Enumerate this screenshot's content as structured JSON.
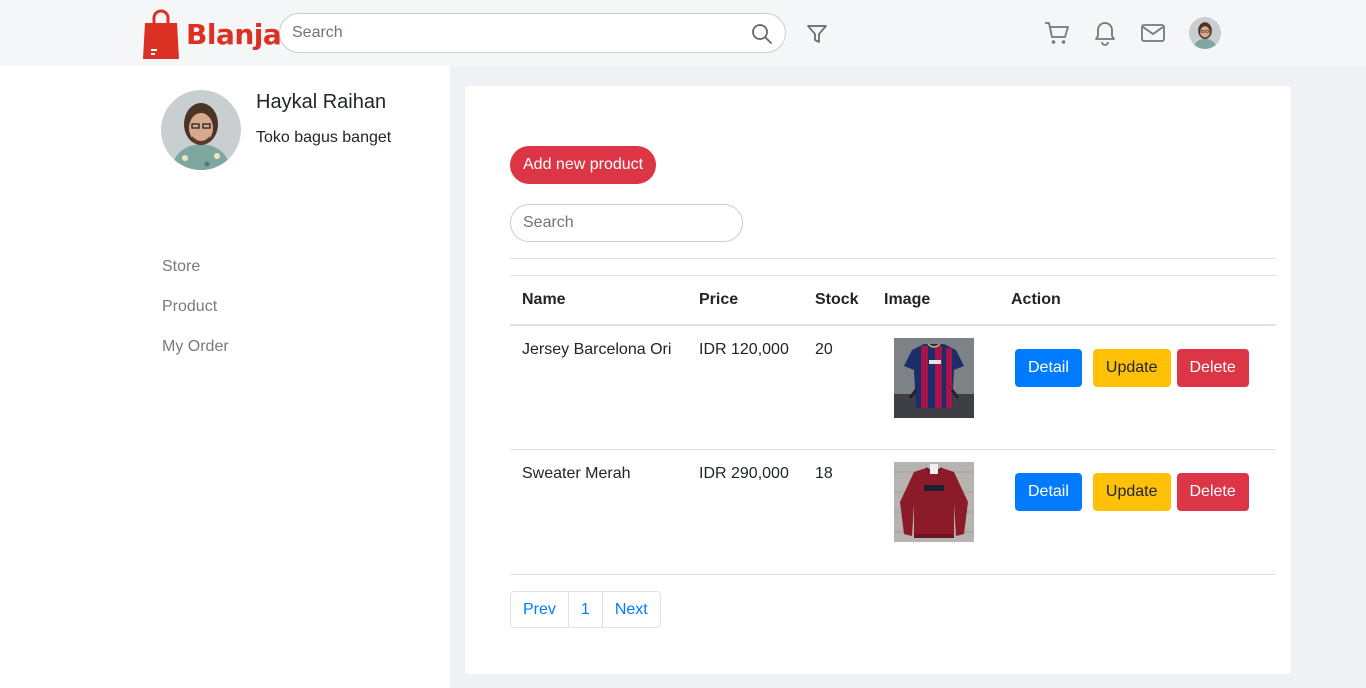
{
  "brand": {
    "name": "Blanja",
    "color": "#db3022"
  },
  "header": {
    "search_placeholder": "Search",
    "icons": [
      "search-icon",
      "filter-icon",
      "cart-icon",
      "bell-icon",
      "mail-icon"
    ]
  },
  "profile": {
    "name": "Haykal Raihan",
    "description": "Toko bagus banget"
  },
  "sidebar": {
    "items": [
      {
        "label": "Store"
      },
      {
        "label": "Product"
      },
      {
        "label": "My Order"
      }
    ]
  },
  "main": {
    "add_label": "Add new product",
    "search_placeholder": "Search",
    "columns": [
      "Name",
      "Price",
      "Stock",
      "Image",
      "Action"
    ],
    "rows": [
      {
        "name": "Jersey Barcelona Ori",
        "price": "IDR 120,000",
        "stock": "20",
        "image": "barcelona-jersey"
      },
      {
        "name": "Sweater Merah",
        "price": "IDR 290,000",
        "stock": "18",
        "image": "red-sweater"
      }
    ],
    "actions": {
      "detail": "Detail",
      "update": "Update",
      "delete": "Delete"
    },
    "pagination": {
      "prev": "Prev",
      "page": "1",
      "next": "Next"
    }
  },
  "colors": {
    "primary": "#007bff",
    "warning": "#ffc107",
    "danger": "#dc3545"
  }
}
